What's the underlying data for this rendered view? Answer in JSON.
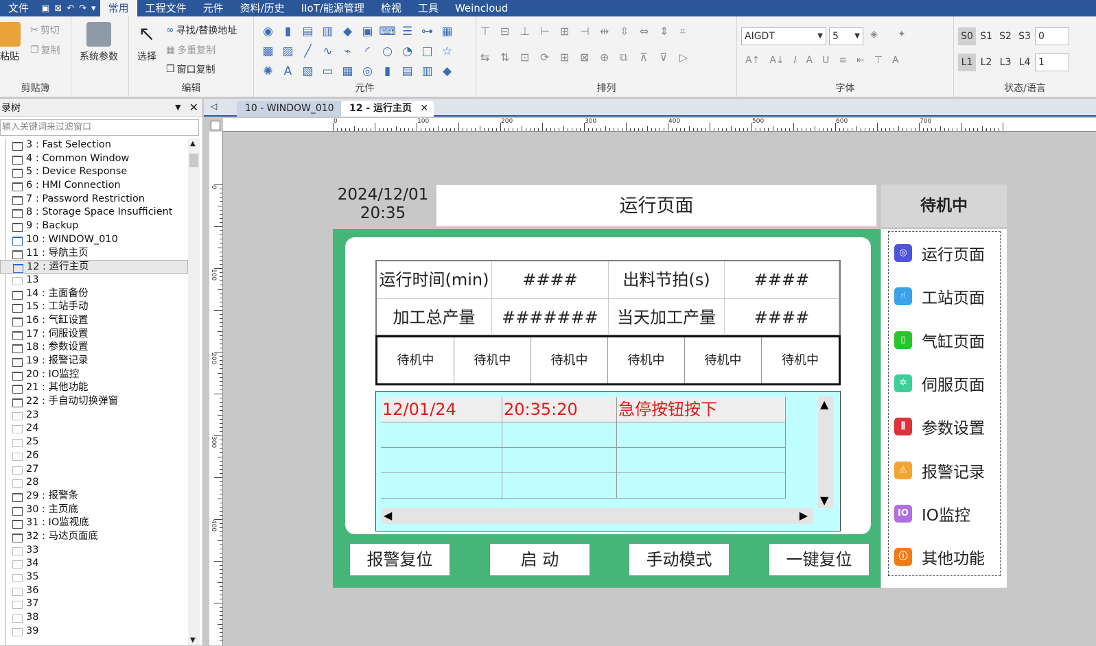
{
  "menu": {
    "items": [
      "文件",
      "常用",
      "工程文件",
      "元件",
      "资料/历史",
      "IIoT/能源管理",
      "检视",
      "工具",
      "Weincloud"
    ],
    "active": "常用"
  },
  "ribbon": {
    "clipboard": {
      "paste": "粘贴",
      "cut": "剪切",
      "copy": "复制",
      "label": "剪贴簿"
    },
    "sysparam": "系统参数",
    "edit": {
      "select": "选择",
      "find": "寻找/替换地址",
      "multi": "多重复制",
      "wincopy": "窗口复制",
      "label": "编辑"
    },
    "components_label": "元件",
    "arrange_label": "排列",
    "font": {
      "name": "AIGDT",
      "size": "5",
      "label": "字体"
    },
    "state": {
      "s": [
        "S0",
        "S1",
        "S2",
        "S3"
      ],
      "l": [
        "L1",
        "L2",
        "L3",
        "L4"
      ],
      "s_value": "0",
      "l_value": "1",
      "label": "状态/语言"
    }
  },
  "tree": {
    "title": "录树",
    "filter_placeholder": "输入关键词来过滤窗口",
    "items": [
      "3 : Fast Selection",
      "4 : Common Window",
      "5 : Device Response",
      "6 : HMI Connection",
      "7 : Password Restriction",
      "8 : Storage Space Insufficient",
      "9 : Backup",
      "10 : WINDOW_010",
      "11 : 导航主页",
      "12 : 运行主页",
      "13",
      "14 : 主面备份",
      "15 : 工站手动",
      "16 : 气缸设置",
      "17 : 伺服设置",
      "18 : 参数设置",
      "19 : 报警记录",
      "20 : IO监控",
      "21 : 其他功能",
      "22 : 手自动切换弹窗",
      "23",
      "24",
      "25",
      "26",
      "27",
      "28",
      "29 : 报警条",
      "30 : 主页底",
      "31 : IO监视底",
      "32 : 马达页面底",
      "33",
      "34",
      "35",
      "36",
      "37",
      "38",
      "39"
    ]
  },
  "tabs": [
    {
      "label": "10 - WINDOW_010"
    },
    {
      "label": "12 - 运行主页"
    }
  ],
  "ruler": {
    "h": [
      "0",
      "100",
      "200",
      "300",
      "400",
      "500",
      "600",
      "700"
    ],
    "v": [
      "0",
      "100",
      "200",
      "300",
      "400"
    ]
  },
  "screen": {
    "date": "2024/12/01",
    "time": "20:35",
    "title": "运行页面",
    "status": "待机中",
    "info": {
      "run_time_label": "运行时间(min)",
      "run_time_value": "####",
      "beat_label": "出料节拍(s)",
      "beat_value": "####",
      "total_label": "加工总产量",
      "total_value": "#######",
      "today_label": "当天加工产量",
      "today_value": "####"
    },
    "stations": [
      "待机中",
      "待机中",
      "待机中",
      "待机中",
      "待机中",
      "待机中"
    ],
    "alarm": {
      "date": "12/01/24",
      "time": "20:35:20",
      "message": "急停按钮按下"
    },
    "buttons": [
      "报警复位",
      "启  动",
      "手动模式",
      "一键复位"
    ],
    "nav": [
      {
        "label": "运行页面",
        "color": "#4d55d8"
      },
      {
        "label": "工站页面",
        "color": "#3aa3e8"
      },
      {
        "label": "气缸页面",
        "color": "#2bc52b"
      },
      {
        "label": "伺服页面",
        "color": "#3ccf9a"
      },
      {
        "label": "参数设置",
        "color": "#e0313b"
      },
      {
        "label": "报警记录",
        "color": "#f3a531"
      },
      {
        "label": "IO监控",
        "color": "#b06fe0"
      },
      {
        "label": "其他功能",
        "color": "#f07a16"
      }
    ]
  }
}
